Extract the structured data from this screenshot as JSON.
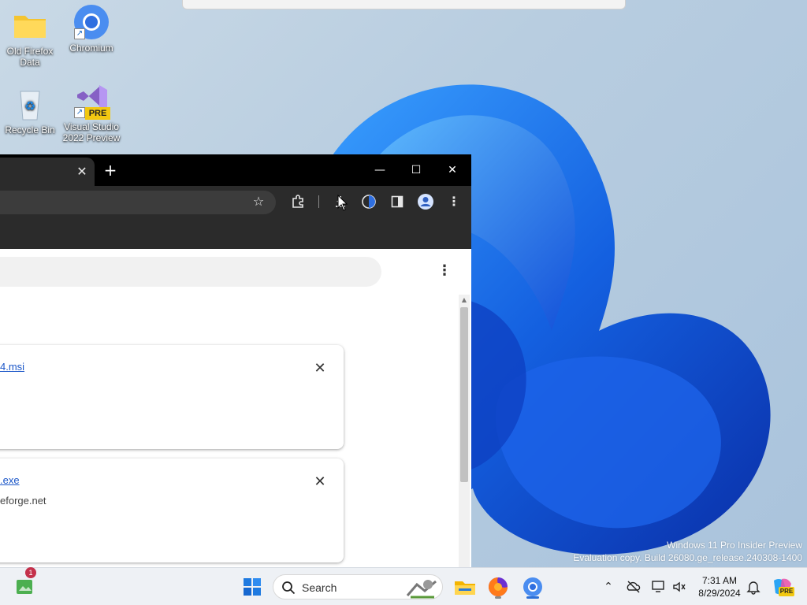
{
  "desktop": {
    "icons": [
      {
        "label": "Old Firefox Data"
      },
      {
        "label": "Chromium"
      },
      {
        "label": "Recycle Bin"
      },
      {
        "label": "Visual Studio 2022 Preview"
      }
    ],
    "vs_badge": "PRE"
  },
  "browser": {
    "tab_close_glyph": "✕",
    "new_tab_glyph": "+",
    "controls": {
      "minimize": "—",
      "maximize": "☐",
      "close": "✕"
    },
    "toolbar_icons": [
      "star-icon",
      "extensions-icon",
      "downloads-icon",
      "history-icon",
      "side-panel-icon",
      "profile-icon",
      "menu-icon"
    ],
    "page": {
      "more_glyph": "⋮",
      "downloads": [
        {
          "link": "4.msi",
          "source": ""
        },
        {
          "link": ".exe",
          "source": "eforge.net"
        }
      ],
      "remove_glyph": "✕"
    }
  },
  "watermark": {
    "line1": "Windows 11 Pro Insider Preview",
    "line2": "Evaluation copy. Build 26080.ge_release.240308-1400"
  },
  "taskbar": {
    "search_label": "Search",
    "notification_count": "1",
    "clock": {
      "time": "7:31 AM",
      "date": "8/29/2024"
    },
    "copilot_badge": "PRE"
  },
  "colors": {
    "accent": "#2b6fd6",
    "link": "#1a56c8",
    "browser_dark": "#2b2b2b"
  }
}
